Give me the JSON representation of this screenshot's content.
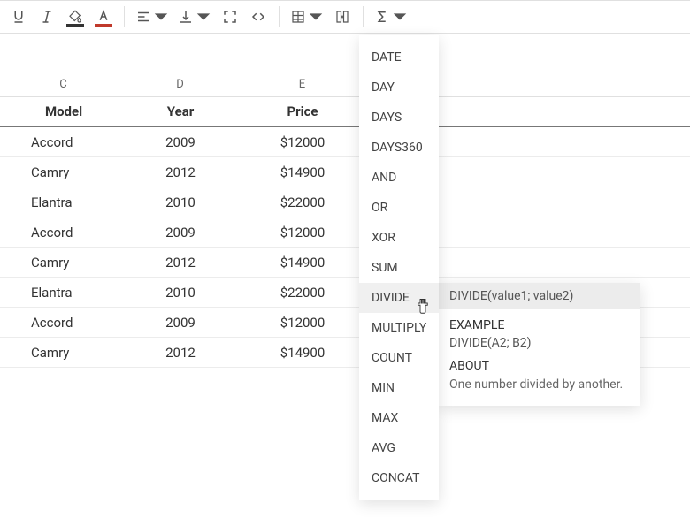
{
  "columns": {
    "c": "C",
    "d": "D",
    "e": "E"
  },
  "headers": {
    "c": "Model",
    "d": "Year",
    "e": "Price"
  },
  "rows": [
    {
      "c": "Accord",
      "d": "2009",
      "e": "$12000"
    },
    {
      "c": "Camry",
      "d": "2012",
      "e": "$14900"
    },
    {
      "c": "Elantra",
      "d": "2010",
      "e": "$22000"
    },
    {
      "c": "Accord",
      "d": "2009",
      "e": "$12000"
    },
    {
      "c": "Camry",
      "d": "2012",
      "e": "$14900"
    },
    {
      "c": "Elantra",
      "d": "2010",
      "e": "$22000"
    },
    {
      "c": "Accord",
      "d": "2009",
      "e": "$12000"
    },
    {
      "c": "Camry",
      "d": "2012",
      "e": "$14900"
    }
  ],
  "function_menu": [
    "DATE",
    "DAY",
    "DAYS",
    "DAYS360",
    "AND",
    "OR",
    "XOR",
    "SUM",
    "DIVIDE",
    "MULTIPLY",
    "COUNT",
    "MIN",
    "MAX",
    "AVG",
    "CONCAT"
  ],
  "hovered_function_index": 8,
  "tooltip": {
    "signature": "DIVIDE(value1; value2)",
    "example_label": "EXAMPLE",
    "example": "DIVIDE(A2; B2)",
    "about_label": "ABOUT",
    "description": "One number divided by another."
  }
}
